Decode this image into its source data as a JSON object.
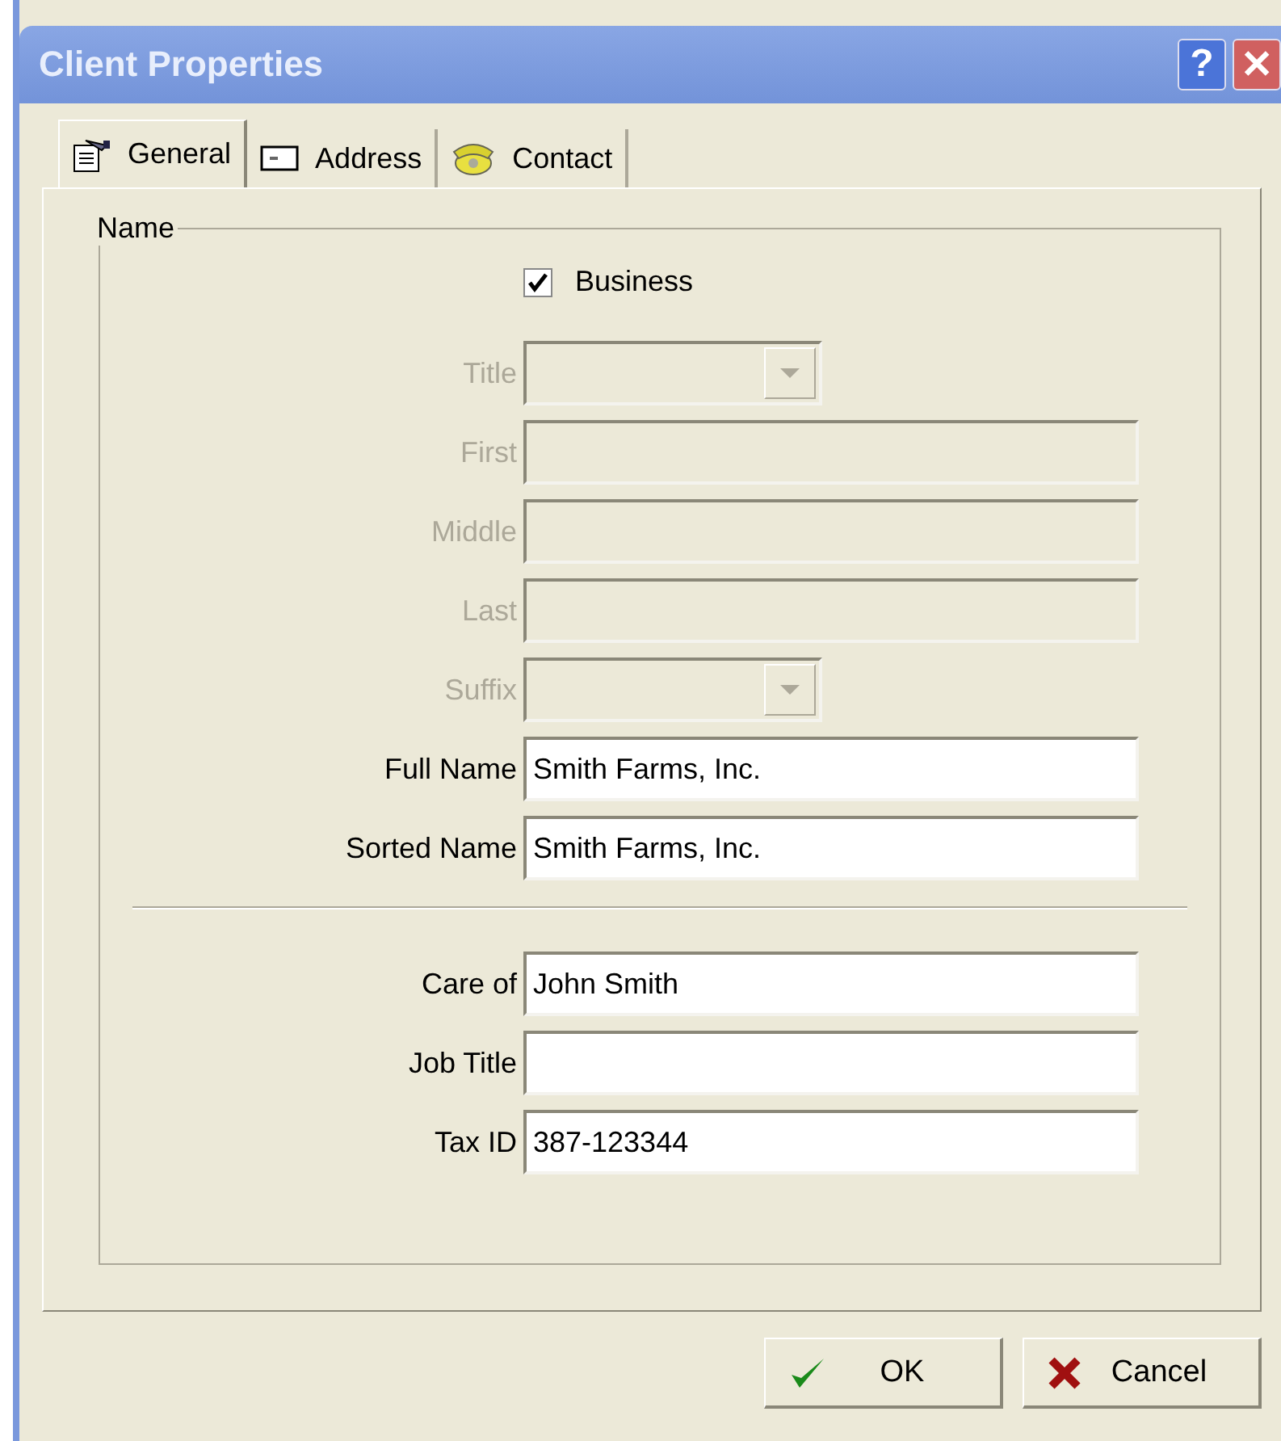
{
  "window": {
    "title": "Client Properties",
    "help_button": "?",
    "close_button": "✕"
  },
  "tabs": [
    {
      "label": "General",
      "selected": true
    },
    {
      "label": "Address",
      "selected": false
    },
    {
      "label": "Contact",
      "selected": false
    }
  ],
  "name_group": {
    "label": "Name",
    "business": {
      "label": "Business",
      "checked": true
    },
    "fields": [
      {
        "label": "Title",
        "kind": "combo",
        "disabled": true
      },
      {
        "label": "First",
        "kind": "text",
        "disabled": true
      },
      {
        "label": "Middle",
        "kind": "text",
        "disabled": true
      },
      {
        "label": "Last",
        "kind": "text",
        "disabled": true
      },
      {
        "label": "Suffix",
        "kind": "combo",
        "disabled": true
      },
      {
        "label": "Full Name",
        "kind": "text",
        "disabled": false,
        "value": "Smith Farms, Inc."
      },
      {
        "label": "Sorted Name",
        "kind": "text",
        "disabled": false,
        "value": "Smith Farms, Inc."
      }
    ],
    "other_fields": [
      {
        "label": "Care of",
        "kind": "text",
        "disabled": false,
        "value": "John Smith"
      },
      {
        "label": "Job Title",
        "kind": "text",
        "disabled": false
      },
      {
        "label": "Tax ID",
        "kind": "text",
        "disabled": false,
        "value": "387-123344"
      }
    ]
  },
  "buttons": [
    {
      "label": "OK",
      "kind": "ok"
    },
    {
      "label": "Cancel",
      "kind": "cancel"
    }
  ]
}
